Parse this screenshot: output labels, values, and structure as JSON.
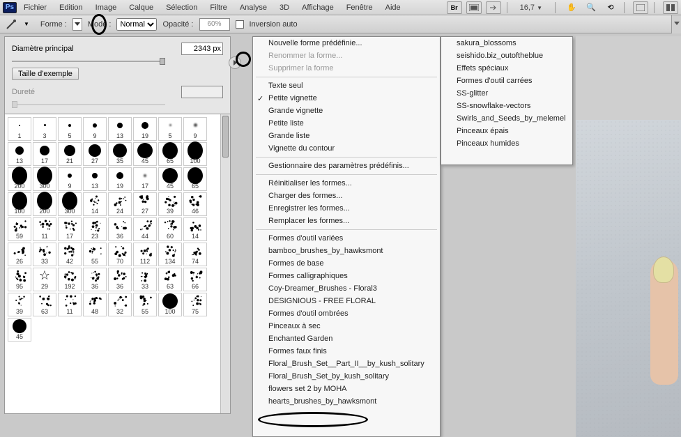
{
  "menubar": {
    "logo": "Ps",
    "items": [
      "Fichier",
      "Edition",
      "Image",
      "Calque",
      "Sélection",
      "Filtre",
      "Analyse",
      "3D",
      "Affichage",
      "Fenêtre",
      "Aide"
    ],
    "icon_br": "Br",
    "zoom": "16,7"
  },
  "optbar": {
    "forme": "Forme :",
    "mode": "Mode :",
    "mode_value": "Normal",
    "opacite": "Opacité :",
    "opacite_value": "60%",
    "inversion": "Inversion auto"
  },
  "brush_panel": {
    "diameter_label": "Diamètre principal",
    "diameter_value": "2343 px",
    "sample_btn": "Taille d'exemple",
    "hardness_label": "Dureté",
    "grid": [
      {
        "s": 2,
        "n": "1"
      },
      {
        "s": 3,
        "n": "3"
      },
      {
        "s": 4,
        "n": "5"
      },
      {
        "s": 6,
        "n": "9"
      },
      {
        "s": 8,
        "n": "13"
      },
      {
        "s": 10,
        "n": "19"
      },
      {
        "s": 3,
        "n": "5",
        "soft": true
      },
      {
        "s": 5,
        "n": "9",
        "soft": true
      },
      {
        "s": 12,
        "n": "13"
      },
      {
        "s": 14,
        "n": "17"
      },
      {
        "s": 16,
        "n": "21"
      },
      {
        "s": 18,
        "n": "27"
      },
      {
        "s": 20,
        "n": "35"
      },
      {
        "s": 22,
        "n": "45"
      },
      {
        "s": 24,
        "n": "65"
      },
      {
        "s": 26,
        "n": "100"
      },
      {
        "s": 26,
        "n": "200"
      },
      {
        "s": 26,
        "n": "300"
      },
      {
        "s": 6,
        "n": "9"
      },
      {
        "s": 8,
        "n": "13"
      },
      {
        "s": 10,
        "n": "19"
      },
      {
        "s": 4,
        "n": "17",
        "soft": true
      },
      {
        "s": 22,
        "n": "45"
      },
      {
        "s": 24,
        "n": "65"
      },
      {
        "s": 26,
        "n": "100"
      },
      {
        "s": 26,
        "n": "200"
      },
      {
        "s": 26,
        "n": "300"
      },
      {
        "s": 10,
        "n": "14",
        "tex": "splat"
      },
      {
        "s": 10,
        "n": "24",
        "tex": "splat"
      },
      {
        "s": 12,
        "n": "27",
        "tex": "splat"
      },
      {
        "s": 14,
        "n": "39",
        "tex": "splat"
      },
      {
        "s": 16,
        "n": "46",
        "tex": "splat"
      },
      {
        "s": 16,
        "n": "59",
        "tex": "spark"
      },
      {
        "s": 6,
        "n": "11",
        "tex": "dash"
      },
      {
        "s": 8,
        "n": "17",
        "tex": "dash"
      },
      {
        "s": 10,
        "n": "23",
        "tex": "chalk"
      },
      {
        "s": 12,
        "n": "36",
        "tex": "chalk"
      },
      {
        "s": 14,
        "n": "44",
        "tex": "chalk"
      },
      {
        "s": 16,
        "n": "60",
        "tex": "chalk"
      },
      {
        "s": 10,
        "n": "14",
        "tex": "leaf"
      },
      {
        "s": 6,
        "n": "26",
        "tex": "dot"
      },
      {
        "s": 10,
        "n": "33",
        "tex": "splat"
      },
      {
        "s": 3,
        "n": "42",
        "tex": "wave"
      },
      {
        "s": 14,
        "n": "55",
        "tex": "splat"
      },
      {
        "s": 16,
        "n": "70",
        "tex": "splat"
      },
      {
        "s": 2,
        "n": "112",
        "tex": "line"
      },
      {
        "s": 18,
        "n": "134",
        "tex": "grass"
      },
      {
        "s": 16,
        "n": "74",
        "tex": "fly"
      },
      {
        "s": 14,
        "n": "95",
        "tex": "splat"
      },
      {
        "s": 0,
        "n": "29",
        "tex": "star"
      },
      {
        "s": 16,
        "n": "192",
        "tex": "splat"
      },
      {
        "s": 14,
        "n": "36",
        "tex": "chalk"
      },
      {
        "s": 16,
        "n": "36",
        "tex": "chalk"
      },
      {
        "s": 14,
        "n": "33",
        "tex": "splat"
      },
      {
        "s": 16,
        "n": "63",
        "tex": "splat"
      },
      {
        "s": 12,
        "n": "66",
        "tex": "dots"
      },
      {
        "s": 14,
        "n": "39",
        "tex": "swirl"
      },
      {
        "s": 10,
        "n": "63",
        "tex": "brush"
      },
      {
        "s": 6,
        "n": "11",
        "tex": "brush"
      },
      {
        "s": 14,
        "n": "48",
        "tex": "splat"
      },
      {
        "s": 14,
        "n": "32",
        "tex": "chalk"
      },
      {
        "s": 16,
        "n": "55",
        "tex": "chalk"
      },
      {
        "s": 22,
        "n": "100"
      },
      {
        "s": 18,
        "n": "75",
        "tex": "splat"
      },
      {
        "s": 20,
        "n": "45"
      }
    ]
  },
  "flyout_menu": {
    "col1": [
      {
        "t": "Nouvelle forme prédéfinie...",
        "type": "item"
      },
      {
        "t": "Renommer la forme...",
        "type": "item",
        "disabled": true
      },
      {
        "t": "Supprimer la forme",
        "type": "item",
        "disabled": true
      },
      {
        "type": "sep"
      },
      {
        "t": "Texte seul",
        "type": "item"
      },
      {
        "t": "Petite vignette",
        "type": "item",
        "checked": true
      },
      {
        "t": "Grande vignette",
        "type": "item"
      },
      {
        "t": "Petite liste",
        "type": "item"
      },
      {
        "t": "Grande liste",
        "type": "item"
      },
      {
        "t": "Vignette du contour",
        "type": "item"
      },
      {
        "type": "sep"
      },
      {
        "t": "Gestionnaire des paramètres prédéfinis...",
        "type": "item"
      },
      {
        "type": "sep"
      },
      {
        "t": "Réinitialiser les formes...",
        "type": "item"
      },
      {
        "t": "Charger des formes...",
        "type": "item"
      },
      {
        "t": "Enregistrer les formes...",
        "type": "item"
      },
      {
        "t": "Remplacer les formes...",
        "type": "item"
      },
      {
        "type": "sep"
      },
      {
        "t": "Formes d'outil variées",
        "type": "item"
      },
      {
        "t": "bamboo_brushes_by_hawksmont",
        "type": "item"
      },
      {
        "t": "Formes de base",
        "type": "item"
      },
      {
        "t": "Formes calligraphiques",
        "type": "item"
      },
      {
        "t": "Coy-Dreamer_Brushes - Floral3",
        "type": "item"
      },
      {
        "t": "DESIGNIOUS - FREE FLORAL",
        "type": "item"
      },
      {
        "t": "Formes d'outil ombrées",
        "type": "item"
      },
      {
        "t": "Pinceaux à sec",
        "type": "item"
      },
      {
        "t": "Enchanted Garden",
        "type": "item"
      },
      {
        "t": "Formes faux finis",
        "type": "item"
      },
      {
        "t": "Floral_Brush_Set__Part_II__by_kush_solitary",
        "type": "item"
      },
      {
        "t": "Floral_Brush_Set_by_kush_solitary",
        "type": "item"
      },
      {
        "t": "flowers set 2 by MOHA",
        "type": "item"
      },
      {
        "t": "hearts_brushes_by_hawksmont",
        "type": "item"
      }
    ],
    "col2": [
      {
        "t": "sakura_blossoms"
      },
      {
        "t": "seishido.biz_outoftheblue"
      },
      {
        "t": "Effets spéciaux"
      },
      {
        "t": "Formes d'outil carrées"
      },
      {
        "t": "SS-glitter"
      },
      {
        "t": "SS-snowflake-vectors"
      },
      {
        "t": "Swirls_and_Seeds_by_melemel"
      },
      {
        "t": "Pinceaux épais"
      },
      {
        "t": "Pinceaux humides"
      }
    ]
  }
}
